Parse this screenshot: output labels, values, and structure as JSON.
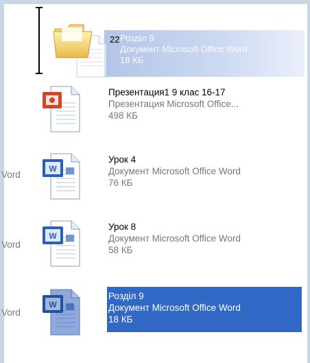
{
  "drag": {
    "count": "22",
    "name": "Розділ 9",
    "type": "Документ Microsoft Office Word",
    "size": "18 КБ"
  },
  "files": [
    {
      "name": "Презентация1 9 клас 16-17",
      "type": "Презентация Microsoft Office...",
      "size": "498 КБ",
      "clipped_type": "",
      "icon": "powerpoint-document-icon"
    },
    {
      "name": "Урок 4",
      "type": "Документ Microsoft Office Word",
      "size": "76 КБ",
      "clipped_type": "Vord",
      "icon": "word-document-icon"
    },
    {
      "name": "Урок 8",
      "type": "Документ Microsoft Office Word",
      "size": "58 КБ",
      "clipped_type": "Vord",
      "icon": "word-document-icon"
    },
    {
      "name": "Розділ 9",
      "type": "Документ Microsoft Office Word",
      "size": "18 КБ",
      "clipped_type": "Vord",
      "icon": "word-document-icon",
      "selected": true
    }
  ],
  "colors": {
    "selection": "#3168c6",
    "frame": "#c9d6e6",
    "ppt_red": "#d24625",
    "word_blue": "#2b5fb0"
  }
}
